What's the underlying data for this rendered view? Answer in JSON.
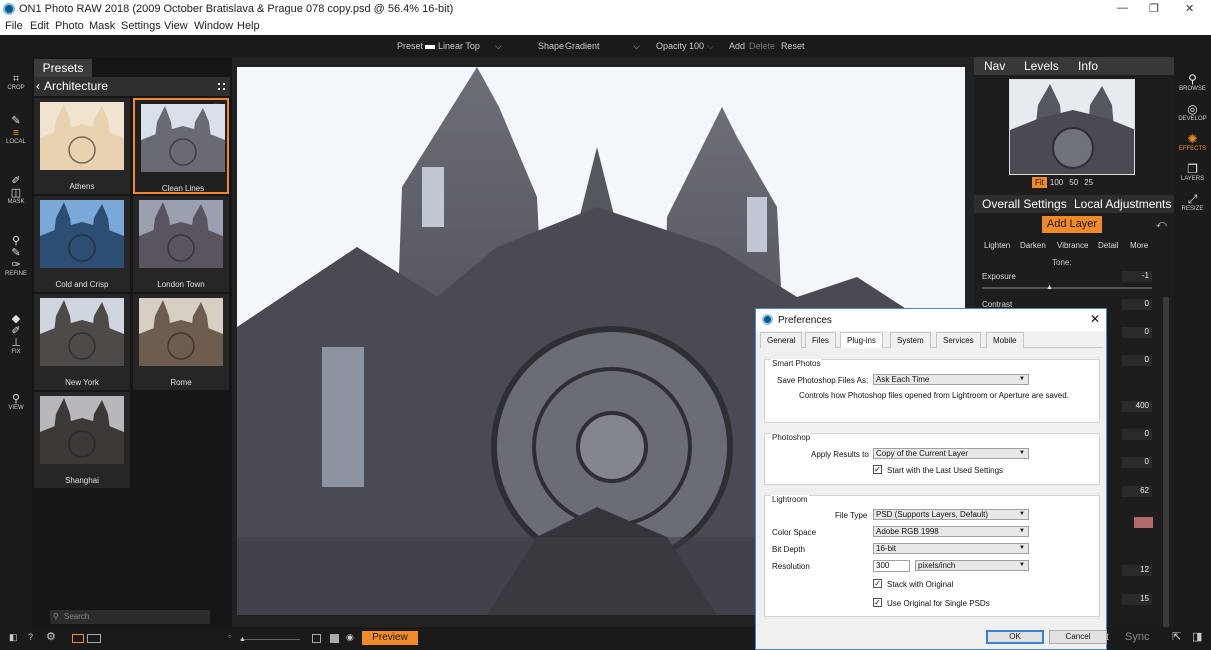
{
  "app": {
    "title": "ON1 Photo RAW 2018 (2009 October Bratislava & Prague 078 copy.psd @ 56.4% 16-bit)",
    "window_controls": [
      "—",
      "❐",
      "✕"
    ]
  },
  "menu": [
    "File",
    "Edit",
    "Photo",
    "Mask",
    "Settings",
    "View",
    "Window",
    "Help"
  ],
  "optionbar": {
    "preset_label": "Preset",
    "preset_value": "Linear Top",
    "shape_label": "Shape",
    "shape_value": "Gradient",
    "opacity_label": "Opacity",
    "opacity_value": "100",
    "add": "Add",
    "delete": "Delete",
    "reset": "Reset"
  },
  "tools": [
    {
      "icon": "crop-icon",
      "label": "CROP"
    },
    {
      "icon": "local-brush-icon",
      "label": "LOCAL"
    },
    {
      "icon": "mask-brush-icon",
      "label": "MASK"
    },
    {
      "icon": "refine-icon",
      "label": "REFINE"
    },
    {
      "icon": "fix-icon",
      "label": "FIX"
    },
    {
      "icon": "view-icon",
      "label": "VIEW"
    }
  ],
  "presets": {
    "tab": "Presets",
    "category": "Architecture",
    "items": [
      {
        "name": "Athens",
        "tint": "#e8d2b0",
        "sky": "#f0e4d0"
      },
      {
        "name": "Clean Lines",
        "tint": "#6a6a74",
        "sky": "#d8e0ea",
        "selected": true
      },
      {
        "name": "Cold and Crisp",
        "tint": "#2c4e72",
        "sky": "#7aa8d8"
      },
      {
        "name": "London Town",
        "tint": "#5a5460",
        "sky": "#9aa0b0"
      },
      {
        "name": "New York",
        "tint": "#4e4a48",
        "sky": "#cfd6e0"
      },
      {
        "name": "Rome",
        "tint": "#6e5c4e",
        "sky": "#d8cfc4"
      },
      {
        "name": "Shanghai",
        "tint": "#3c3836",
        "sky": "#b8b8bc"
      }
    ],
    "search_placeholder": "Search"
  },
  "nav": {
    "tabs": [
      "Nav",
      "Levels",
      "Info"
    ],
    "zoom": [
      "Fit",
      "100",
      "50",
      "25"
    ],
    "active_zoom": "Fit"
  },
  "adjust": {
    "tabs": [
      "Overall Settings",
      "Local Adjustments"
    ],
    "add_layer": "Add Layer",
    "subtabs": [
      "Lighten",
      "Darken",
      "Vibrance",
      "Detail",
      "More"
    ],
    "tone_label": "Tone:",
    "sliders": [
      {
        "label": "Exposure",
        "value": "-1"
      },
      {
        "label": "Contrast",
        "value": "0"
      }
    ],
    "hidden_values": [
      "0",
      "0",
      "400",
      "0",
      "0",
      "62",
      "12",
      "15"
    ]
  },
  "modules": [
    {
      "icon": "browse-icon",
      "label": "BROWSE"
    },
    {
      "icon": "develop-icon",
      "label": "DEVELOP"
    },
    {
      "icon": "effects-icon",
      "label": "EFFECTS",
      "active": true
    },
    {
      "icon": "layers-icon",
      "label": "LAYERS"
    },
    {
      "icon": "resize-icon",
      "label": "RESIZE"
    }
  ],
  "bottombar": {
    "preview": "Preview",
    "sync": "Sync",
    "reset_partial": "t"
  },
  "preferences": {
    "title": "Preferences",
    "tabs": [
      "General",
      "Files",
      "Plug-ins",
      "System",
      "Services",
      "Mobile"
    ],
    "active_tab": "Plug-ins",
    "smart_photos": {
      "group": "Smart Photos",
      "save_label": "Save Photoshop Files As:",
      "save_value": "Ask Each Time",
      "note": "Controls how Photoshop files opened from Lightroom or Aperture are saved."
    },
    "photoshop": {
      "group": "Photoshop",
      "apply_label": "Apply Results to",
      "apply_value": "Copy of the Current Layer",
      "start_last": "Start with the Last Used Settings",
      "start_last_checked": true
    },
    "lightroom": {
      "group": "Lightroom",
      "file_type_label": "File Type",
      "file_type_value": "PSD (Supports Layers, Default)",
      "color_space_label": "Color Space",
      "color_space_value": "Adobe RGB 1998",
      "bit_depth_label": "Bit Depth",
      "bit_depth_value": "16-bit",
      "resolution_label": "Resolution",
      "resolution_value": "300",
      "resolution_unit": "pixels/inch",
      "stack": "Stack with Original",
      "stack_checked": true,
      "use_original": "Use Original for Single PSDs",
      "use_original_checked": true
    },
    "ok": "OK",
    "cancel": "Cancel"
  },
  "colors": {
    "accent": "#f08a28",
    "panel": "#1d1d1d",
    "dialog_border": "#4a86c8"
  }
}
